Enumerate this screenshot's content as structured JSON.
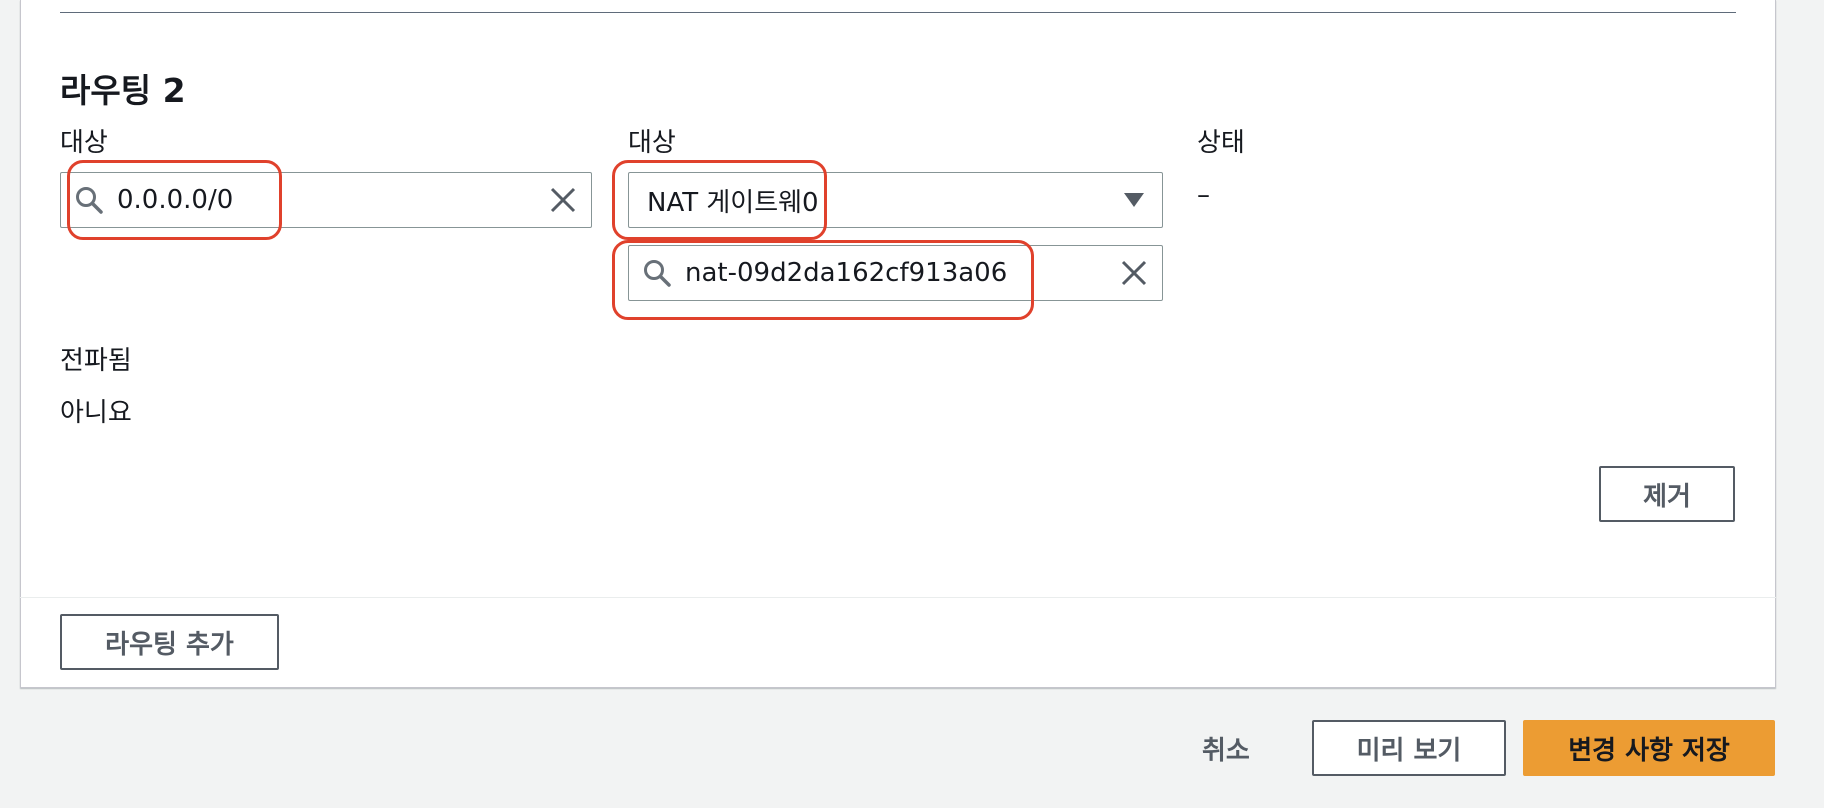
{
  "route": {
    "title": "라우팅 2",
    "destination_label": "대상",
    "destination_value": "0.0.0.0/0",
    "target_label": "대상",
    "target_type_value": "NAT 게이트웨0",
    "target_id_value": "nat-09d2da162cf913a06",
    "status_label": "상태",
    "status_value": "–",
    "propagated_label": "전파됨",
    "propagated_value": "아니요",
    "remove_button": "제거"
  },
  "add_route_button": "라우팅 추가",
  "footer": {
    "cancel": "취소",
    "preview": "미리 보기",
    "save": "변경 사항 저장"
  },
  "colors": {
    "highlight": "#e0412c",
    "primary": "#ec9c33"
  }
}
